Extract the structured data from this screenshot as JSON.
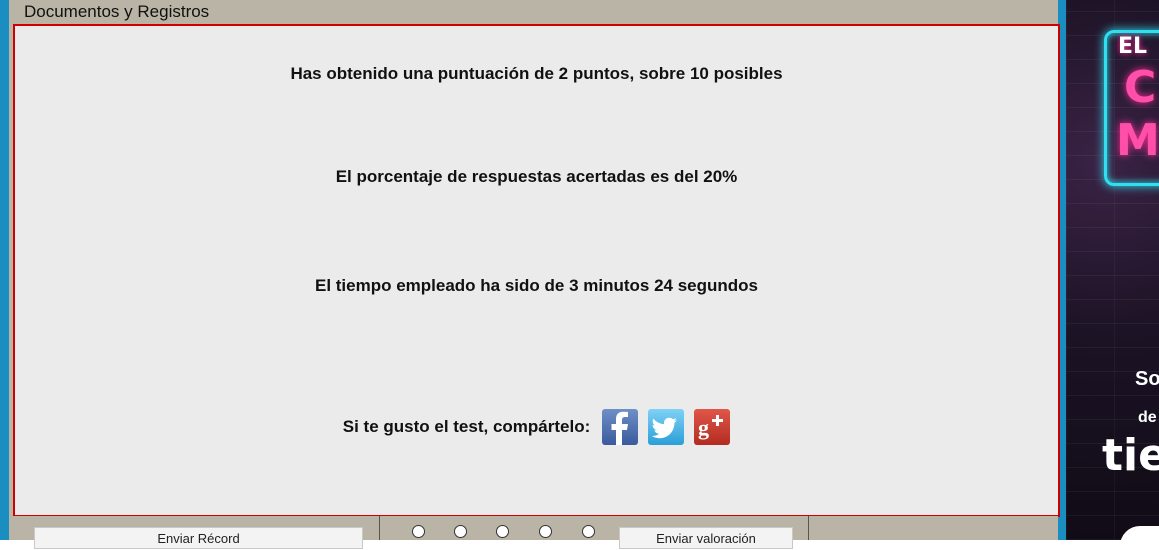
{
  "panel": {
    "title": "Documentos y Registros"
  },
  "results": {
    "score": "Has obtenido una puntuación de 2 puntos, sobre 10 posibles",
    "percentage": "El porcentaje de respuestas acertadas es del 20%",
    "time": "El tiempo empleado ha sido de 3 minutos 24 segundos"
  },
  "share": {
    "label": "Si te gusto el test, compártelo:",
    "icons": [
      "facebook-icon",
      "twitter-icon",
      "google-plus-icon"
    ]
  },
  "bottom_bar": {
    "record_button": "Enviar Récord",
    "rating_button": "Enviar valoración",
    "rating_options_count": 5
  },
  "ad": {
    "top_text": "EL",
    "line1": "C",
    "line2": "M",
    "so": "So",
    "de": "de",
    "brand": "tie"
  },
  "colors": {
    "border_red": "#d00000",
    "frame_gray": "#b9b4a5",
    "accent_blue": "#1a8ec1",
    "content_bg": "#ebebeb"
  }
}
